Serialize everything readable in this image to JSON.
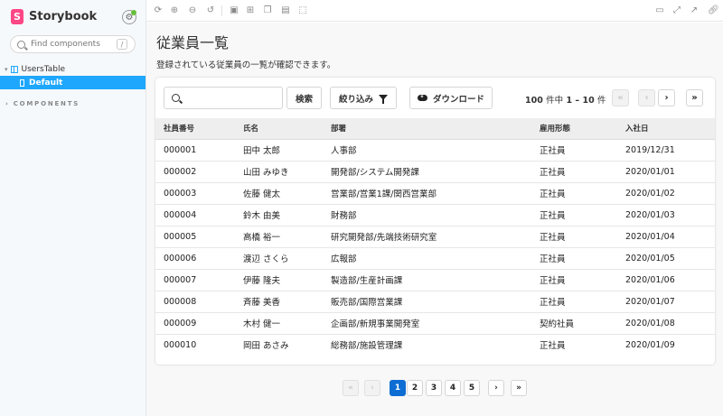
{
  "sidebar": {
    "brand": "Storybook",
    "search_placeholder": "Find components",
    "search_shortcut": "/",
    "component": "UsersTable",
    "story": "Default",
    "section": "COMPONENTS"
  },
  "toolbar": {
    "icons": [
      "sync-icon",
      "zoom-in-icon",
      "zoom-out-icon",
      "zoom-reset-icon",
      "image-icon",
      "grid-icon",
      "component-icon",
      "outline-icon",
      "measure-icon",
      "panel-icon",
      "fullscreen-icon",
      "share-icon",
      "link-icon"
    ]
  },
  "page": {
    "title": "従業員一覧",
    "description": "登録されている従業員の一覧が確認できます。"
  },
  "filters": {
    "search_value": "",
    "search_button": "検索",
    "filter_button": "絞り込み",
    "download_button": "ダウンロード"
  },
  "range": {
    "total": "100",
    "total_unit": "件中",
    "span": "1 – 10",
    "span_unit": "件"
  },
  "table": {
    "headers": [
      "社員番号",
      "氏名",
      "部署",
      "雇用形態",
      "入社日"
    ],
    "rows": [
      [
        "000001",
        "田中 太郎",
        "人事部",
        "正社員",
        "2019/12/31"
      ],
      [
        "000002",
        "山田 みゆき",
        "開発部/システム開発課",
        "正社員",
        "2020/01/01"
      ],
      [
        "000003",
        "佐藤 健太",
        "営業部/営業1課/関西営業部",
        "正社員",
        "2020/01/02"
      ],
      [
        "000004",
        "鈴木 由美",
        "財務部",
        "正社員",
        "2020/01/03"
      ],
      [
        "000005",
        "高橋 裕一",
        "研究開発部/先端技術研究室",
        "正社員",
        "2020/01/04"
      ],
      [
        "000006",
        "渡辺 さくら",
        "広報部",
        "正社員",
        "2020/01/05"
      ],
      [
        "000007",
        "伊藤 隆夫",
        "製造部/生産計画課",
        "正社員",
        "2020/01/06"
      ],
      [
        "000008",
        "斉藤 美香",
        "販売部/国際営業課",
        "正社員",
        "2020/01/07"
      ],
      [
        "000009",
        "木村 健一",
        "企画部/新規事業開発室",
        "契約社員",
        "2020/01/08"
      ],
      [
        "000010",
        "岡田 あさみ",
        "総務部/施設管理課",
        "正社員",
        "2020/01/09"
      ]
    ]
  },
  "pagination": {
    "first": "«",
    "prev": "‹",
    "next": "›",
    "last": "»",
    "pages": [
      "1",
      "2",
      "3",
      "4",
      "5"
    ],
    "current": "1"
  },
  "colors": {
    "accent": "#1ea7fd",
    "brand": "#ff4785",
    "active_page": "#0d6dd3"
  }
}
